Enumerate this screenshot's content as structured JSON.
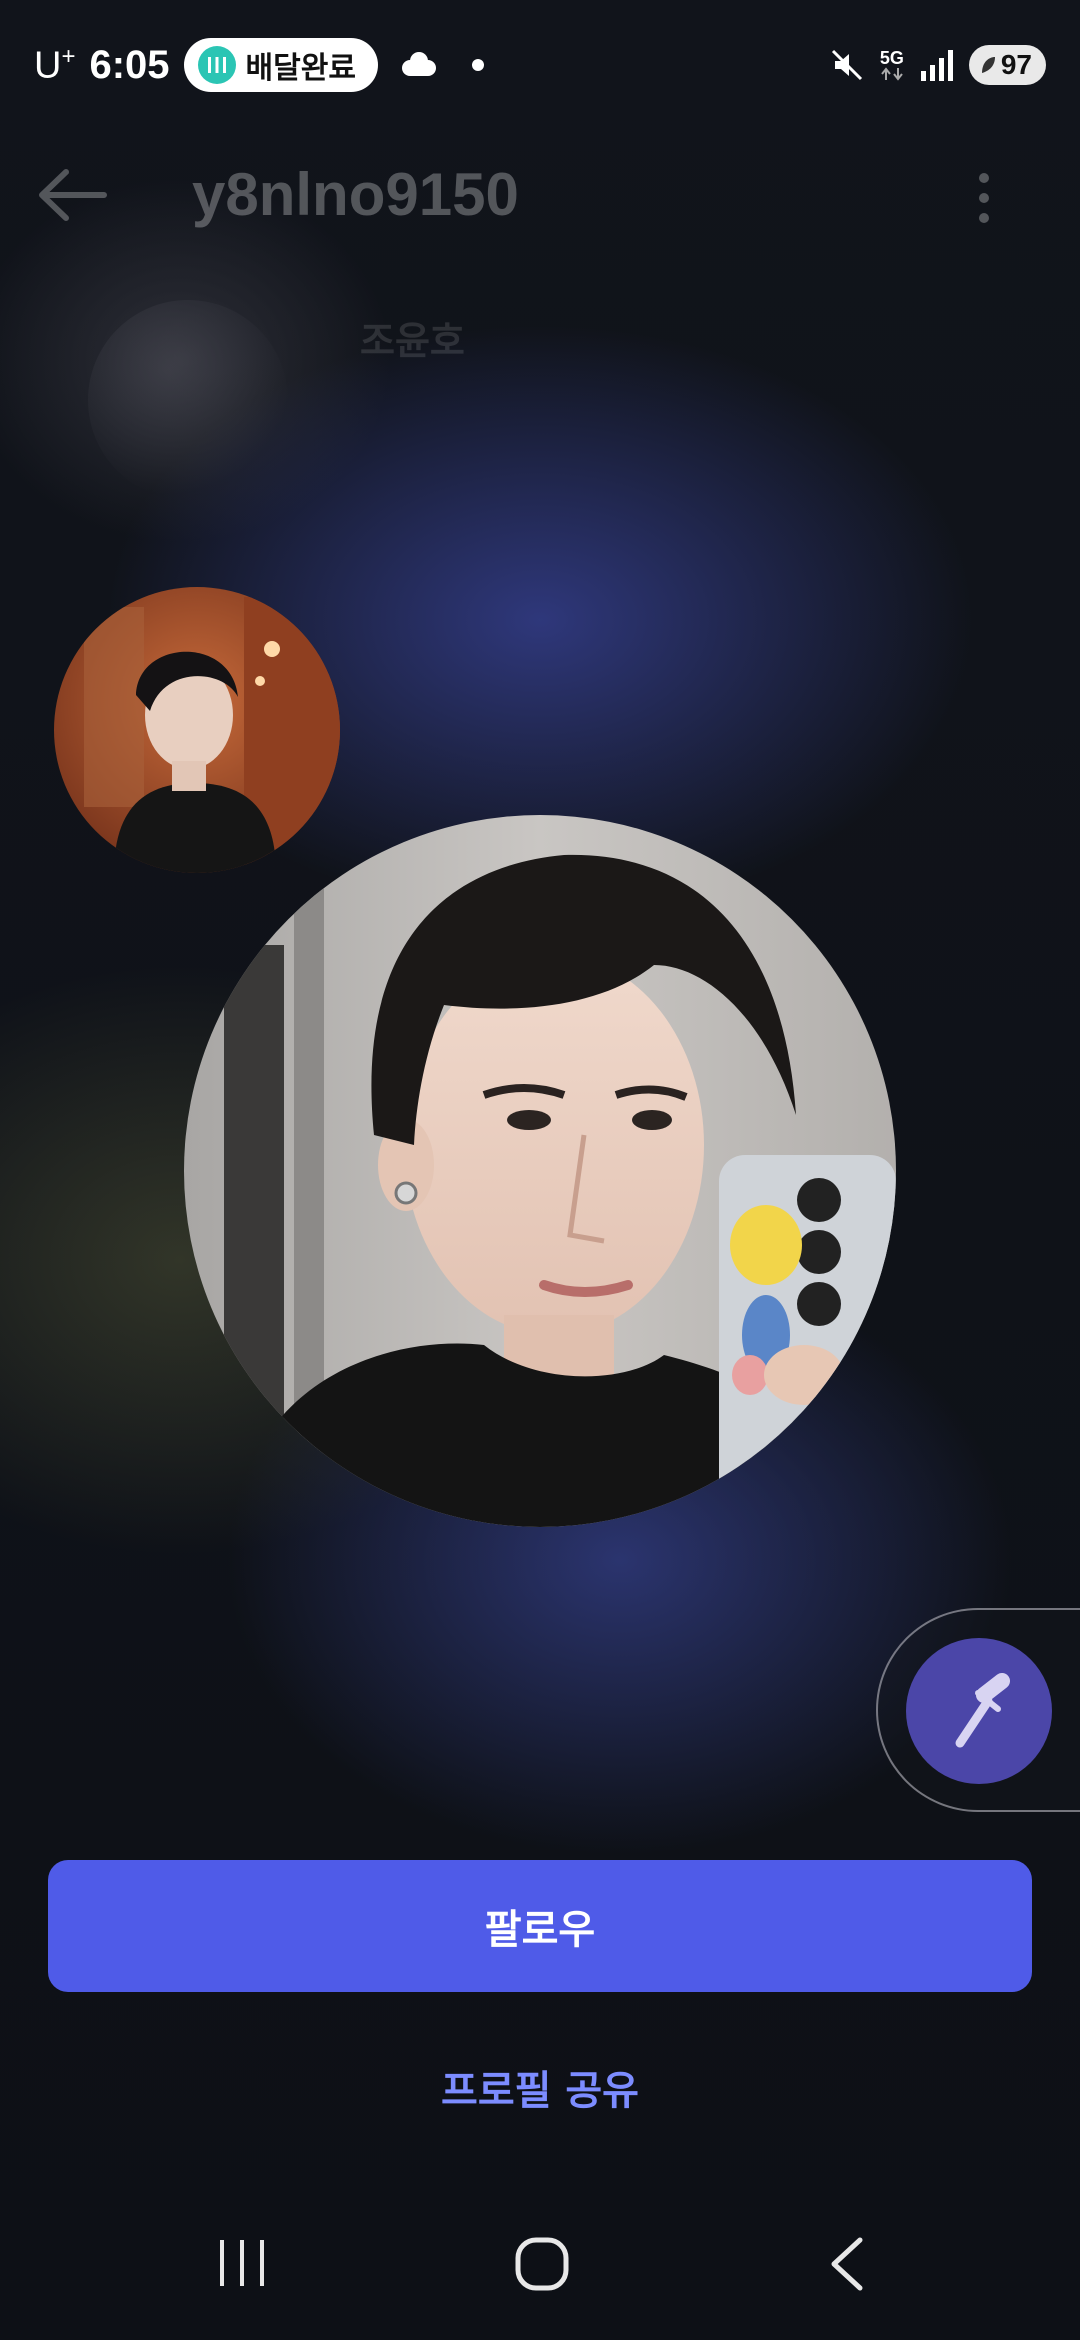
{
  "status_bar": {
    "carrier": "U",
    "carrier_sup": "+",
    "time": "6:05",
    "notification_pill": "배달완료",
    "network": "5G",
    "battery": "97"
  },
  "header": {
    "username": "y8nlno9150",
    "faint_name": "조윤호"
  },
  "actions": {
    "follow": "팔로우",
    "share_profile": "프로필 공유"
  },
  "icons": {
    "back": "back-arrow-icon",
    "more": "more-vertical-icon",
    "eyedropper": "eyedropper-icon",
    "nav_recents": "recents-icon",
    "nav_home": "home-icon",
    "nav_back": "back-chevron-icon"
  },
  "colors": {
    "follow_button": "#4f5be8",
    "share_link": "#7c8cff",
    "eyedropper_bg": "#4b46a8"
  }
}
